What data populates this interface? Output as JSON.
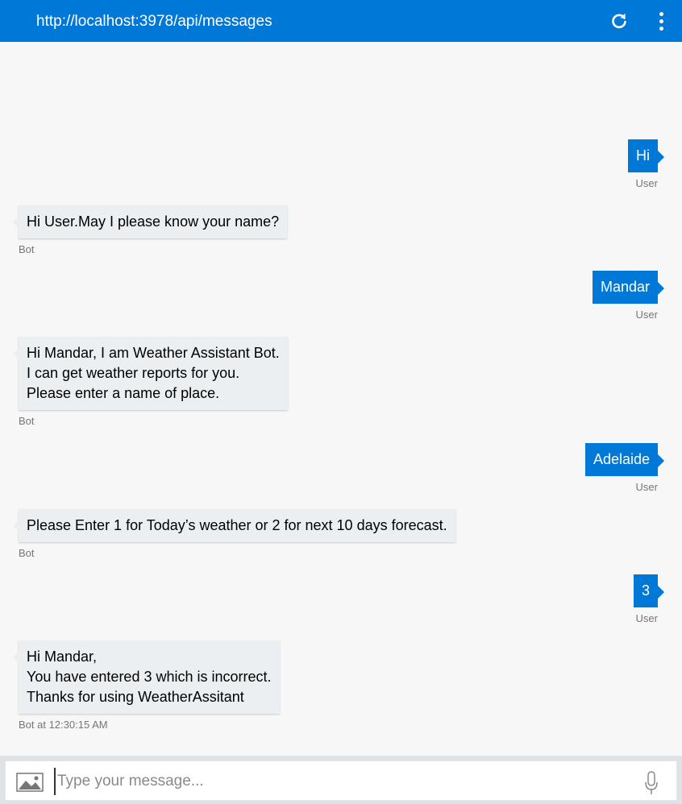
{
  "header": {
    "endpoint": "http://localhost:3978/api/messages",
    "refresh_icon": "refresh-icon",
    "menu_icon": "more-vertical-icon"
  },
  "messages": [
    {
      "from": "user",
      "text": "Hi",
      "label": "User"
    },
    {
      "from": "bot",
      "text": "Hi User.May I please know your name?",
      "label": "Bot"
    },
    {
      "from": "user",
      "text": "Mandar",
      "label": "User"
    },
    {
      "from": "bot",
      "text": "Hi Mandar, I am Weather Assistant Bot.\nI can get weather reports for you.\nPlease enter a name of place.",
      "label": "Bot"
    },
    {
      "from": "user",
      "text": "Adelaide",
      "label": "User"
    },
    {
      "from": "bot",
      "text": "Please Enter 1 for Today’s weather or 2 for next 10 days forecast.",
      "label": "Bot"
    },
    {
      "from": "user",
      "text": "3",
      "label": "User"
    },
    {
      "from": "bot",
      "text": "Hi Mandar,\nYou have entered 3 which is incorrect.\nThanks for using WeatherAssitant",
      "label": "Bot at 12:30:15 AM"
    }
  ],
  "composer": {
    "placeholder": "Type your message...",
    "value": "",
    "upload_icon": "image-upload-icon",
    "mic_icon": "microphone-icon"
  },
  "colors": {
    "accent": "#0078d7",
    "bot_bubble": "#eceff1",
    "background": "#f7f7f7"
  }
}
